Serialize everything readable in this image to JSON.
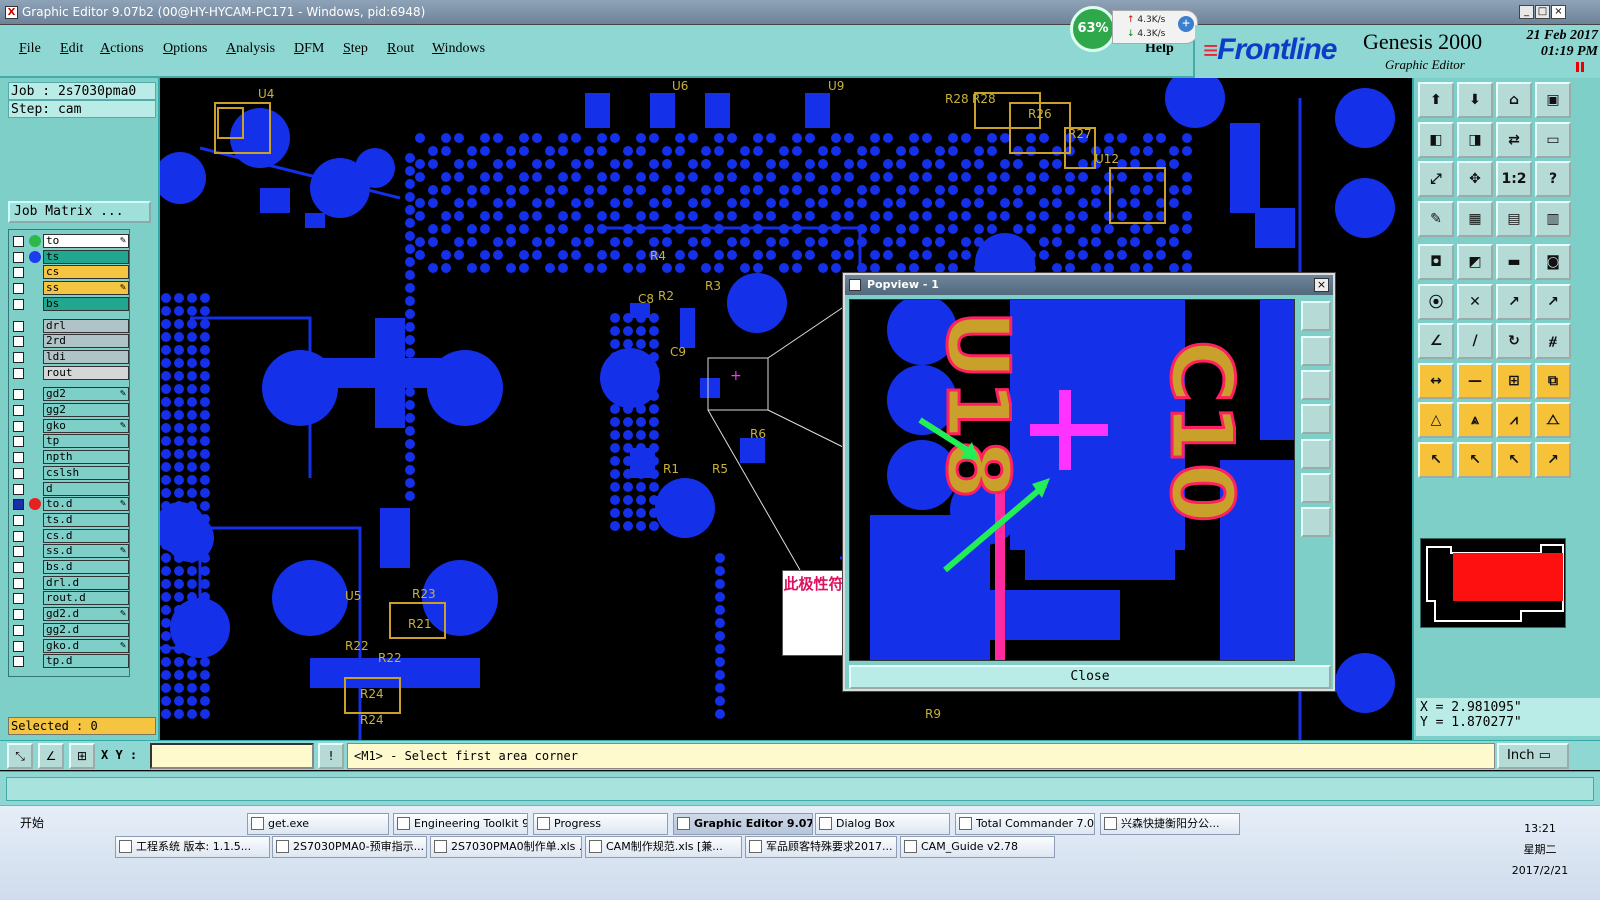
{
  "titlebar": {
    "title": "Graphic Editor 9.07b2 (00@HY-HYCAM-PC171 - Windows, pid:6948)"
  },
  "net_widget": {
    "percent": "63%",
    "up_rate": "4.3K/s",
    "down_rate": "4.3K/s"
  },
  "menu": {
    "items": [
      "File",
      "Edit",
      "Actions",
      "Options",
      "Analysis",
      "DFM",
      "Step",
      "Rout",
      "Windows"
    ],
    "help": "Help"
  },
  "brand": {
    "logo": "Frontline",
    "product": "Genesis 2000",
    "subtitle": "Graphic Editor",
    "date": "21 Feb 2017",
    "time": "01:19 PM"
  },
  "job": {
    "job_line": "Job : 2s7030pma0",
    "step_line": "Step: cam",
    "matrix_button": "Job Matrix ..."
  },
  "layers": [
    {
      "name": "to",
      "color": "#ffffff",
      "dot": "#2db84a",
      "mark": "✎"
    },
    {
      "name": "ts",
      "color": "#21a790",
      "dot": "#1c3cf0",
      "mark": ""
    },
    {
      "name": "cs",
      "color": "#f5c542",
      "dot": "",
      "mark": ""
    },
    {
      "name": "ss",
      "color": "#f5c542",
      "dot": "",
      "mark": "✎"
    },
    {
      "name": "bs",
      "color": "#21a790",
      "dot": "",
      "mark": ""
    },
    {
      "name": "drl",
      "color": "#b0c4c8",
      "dot": "",
      "mark": ""
    },
    {
      "name": "2rd",
      "color": "#b0c4c8",
      "dot": "",
      "mark": ""
    },
    {
      "name": "ldi",
      "color": "#b0c4c8",
      "dot": "",
      "mark": ""
    },
    {
      "name": "rout",
      "color": "#d6d6d6",
      "dot": "",
      "mark": ""
    },
    {
      "name": "gd2",
      "color": "#7fcfc9",
      "dot": "",
      "mark": "✎"
    },
    {
      "name": "gg2",
      "color": "#7fcfc9",
      "dot": "",
      "mark": ""
    },
    {
      "name": "gko",
      "color": "#7fcfc9",
      "dot": "",
      "mark": "✎"
    },
    {
      "name": "tp",
      "color": "#7fcfc9",
      "dot": "",
      "mark": ""
    },
    {
      "name": "npth",
      "color": "#7fcfc9",
      "dot": "",
      "mark": ""
    },
    {
      "name": "cslsh",
      "color": "#7fcfc9",
      "dot": "",
      "mark": ""
    },
    {
      "name": "d",
      "color": "#7fcfc9",
      "dot": "",
      "mark": ""
    },
    {
      "name": "to.d",
      "color": "#7fcfc9",
      "dot": "#e82020",
      "mark": "✎"
    },
    {
      "name": "ts.d",
      "color": "#7fcfc9",
      "dot": "",
      "mark": ""
    },
    {
      "name": "cs.d",
      "color": "#7fcfc9",
      "dot": "",
      "mark": ""
    },
    {
      "name": "ss.d",
      "color": "#7fcfc9",
      "dot": "",
      "mark": "✎"
    },
    {
      "name": "bs.d",
      "color": "#7fcfc9",
      "dot": "",
      "mark": ""
    },
    {
      "name": "drl.d",
      "color": "#7fcfc9",
      "dot": "",
      "mark": ""
    },
    {
      "name": "rout.d",
      "color": "#7fcfc9",
      "dot": "",
      "mark": ""
    },
    {
      "name": "gd2.d",
      "color": "#7fcfc9",
      "dot": "",
      "mark": "✎"
    },
    {
      "name": "gg2.d",
      "color": "#7fcfc9",
      "dot": "",
      "mark": ""
    },
    {
      "name": "gko.d",
      "color": "#7fcfc9",
      "dot": "",
      "mark": "✎"
    },
    {
      "name": "tp.d",
      "color": "#7fcfc9",
      "dot": "",
      "mark": ""
    }
  ],
  "selected": "Selected : 0",
  "pcb_labels": [
    "U4",
    "U6",
    "U9",
    "R28",
    "R28",
    "R26",
    "R27",
    "U12",
    "R4",
    "C8",
    "R2",
    "R3",
    "C9",
    "R1",
    "R5",
    "R6",
    "U5",
    "R23",
    "R21",
    "R22",
    "R22",
    "R24",
    "R24",
    "R9"
  ],
  "popview": {
    "title": "Popview - 1",
    "close_label": "Close",
    "labels": [
      "U18",
      "C10"
    ]
  },
  "annotation": {
    "text": "此极性符号挪到旁边做出一点"
  },
  "coords": {
    "x_line": "X = 2.981095\"",
    "y_line": "Y = 1.870277\""
  },
  "bottom": {
    "xy_label": "X Y :",
    "xy_value": "",
    "message": "<M1> - Select first area corner",
    "unit": "Inch"
  },
  "taskbar": {
    "start": "开始",
    "row1": [
      "get.exe",
      "Engineering Toolkit 9....",
      "Progress",
      "Graphic Editor 9.07...",
      "Dialog Box",
      "Total Commander 7.0...",
      "兴森快捷衡阳分公..."
    ],
    "row2": [
      "工程系统  版本: 1.1.5...",
      "2S7030PMA0-预审指示...",
      "2S7030PMA0制作单.xls ...",
      "CAM制作规范.xls  [兼...",
      "军品顾客特殊要求2017...",
      "CAM_Guide v2.78"
    ],
    "clock_time": "13:21",
    "clock_day": "星期二",
    "clock_date": "2017/2/21"
  }
}
